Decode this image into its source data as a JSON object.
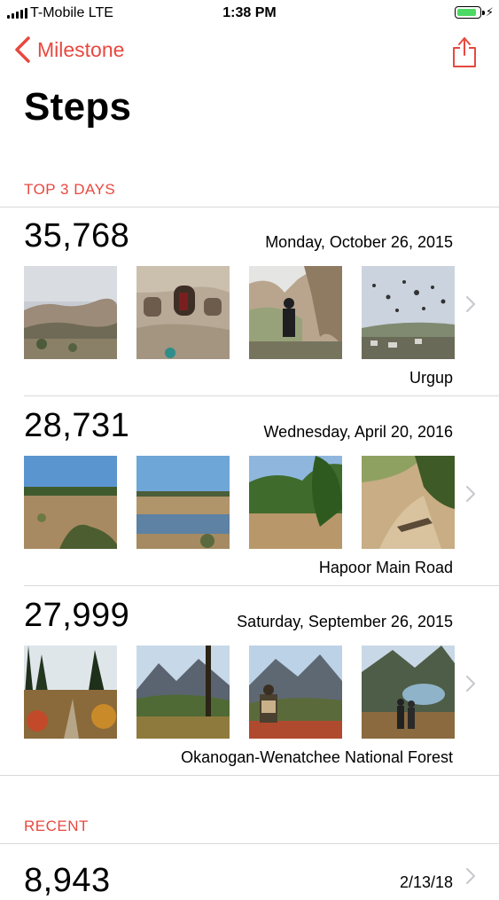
{
  "status_bar": {
    "carrier": "T-Mobile  LTE",
    "time": "1:38 PM",
    "battery_level": 0.9,
    "battery_color": "#4cd964"
  },
  "nav": {
    "back_label": "Milestone",
    "back_icon": "chevron-left-icon",
    "share_icon": "share-icon",
    "accent_color": "#e8483f"
  },
  "title": "Steps",
  "sections": {
    "top_days_header": "TOP 3 DAYS",
    "recent_header": "RECENT"
  },
  "top_days": [
    {
      "steps": "35,768",
      "date": "Monday, October 26, 2015",
      "location": "Urgup",
      "photos": [
        "valley-landscape-photo",
        "cave-dwelling-photo",
        "rock-formation-person-photo",
        "hot-air-balloons-photo"
      ]
    },
    {
      "steps": "28,731",
      "date": "Wednesday, April 20, 2016",
      "location": "Hapoor Main Road",
      "photos": [
        "dry-field-photo",
        "lake-shore-photo",
        "trees-path-photo",
        "dirt-path-tree-photo"
      ]
    },
    {
      "steps": "27,999",
      "date": "Saturday, September 26, 2015",
      "location": "Okanogan-Wenatchee National Forest",
      "photos": [
        "forest-trail-photo",
        "mountain-meadow-photo",
        "hiker-mountains-photo",
        "alpine-lake-couple-photo"
      ]
    }
  ],
  "recent": [
    {
      "steps": "8,943",
      "date": "2/13/18"
    }
  ]
}
